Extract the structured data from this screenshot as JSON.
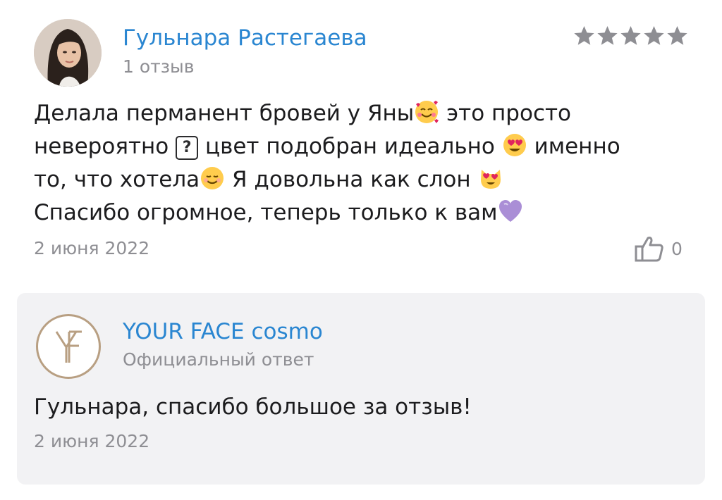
{
  "review": {
    "author_name": "Гульнара Растегаева",
    "author_reviews": "1 отзыв",
    "rating": 5,
    "rating_max": 5,
    "star_color": "#8e8e93",
    "text_lines": [
      {
        "before": "Делала перманент бровей у Яны",
        "emoji": "smiling-face-with-hearts",
        "after": " это просто"
      },
      {
        "before": "невероятно ",
        "symbol": "?",
        "middle": " цвет подобран идеально ",
        "emoji": "heart-eyes",
        "after": " именно"
      },
      {
        "before": "то, что хотела",
        "emoji": "smiling-face",
        "middle": " Я довольна как слон ",
        "emoji2": "heart-eyes-cat"
      },
      {
        "before": "Спасибо огромное, теперь только к вам",
        "emoji": "purple-heart"
      }
    ],
    "date": "2 июня 2022",
    "likes": "0"
  },
  "reply": {
    "name": "YOUR FACE cosmo",
    "label": "Официальный ответ",
    "text": "Гульнара, спасибо большое за отзыв!",
    "date": "2 июня 2022"
  },
  "colors": {
    "link_blue": "#2a86d1",
    "muted_gray": "#8e8e93",
    "card_bg": "#f2f2f4",
    "logo_gold": "#b89f82"
  }
}
